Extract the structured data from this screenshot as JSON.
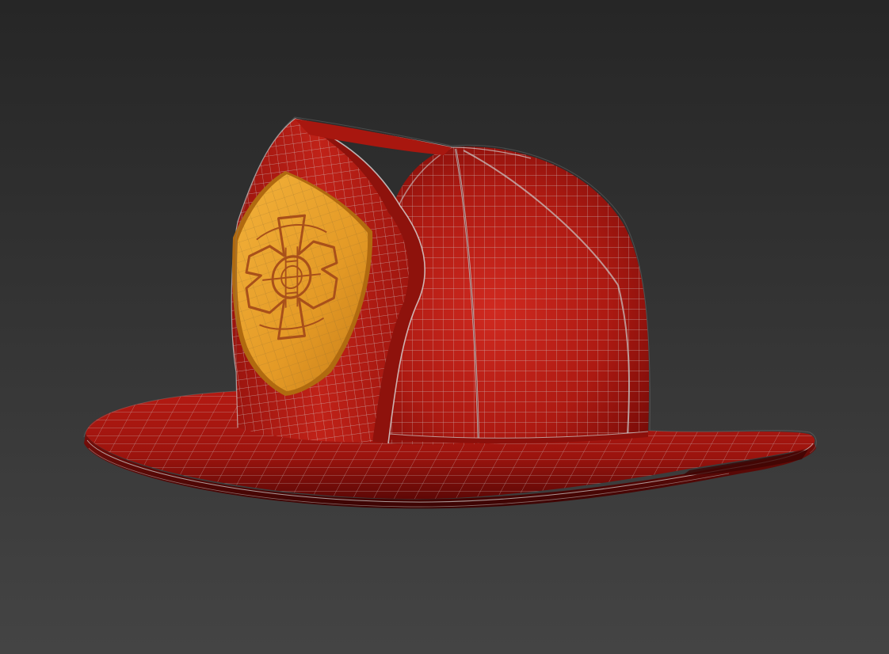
{
  "scene": {
    "subject": "helmet-model",
    "render_mode": "shaded-wireframe",
    "background_top": "#262626",
    "background_bottom": "#444444"
  },
  "helmet": {
    "shell_color": "#b81a14",
    "shell_dark": "#6e0a08",
    "shell_light": "#d23526",
    "wire_color": "#c9c9c9"
  },
  "badge": {
    "fill_color": "#e8a12a",
    "edge_color": "#b06a10",
    "emblem_color": "#a8501a",
    "icon": "maltese-cross-icon"
  }
}
